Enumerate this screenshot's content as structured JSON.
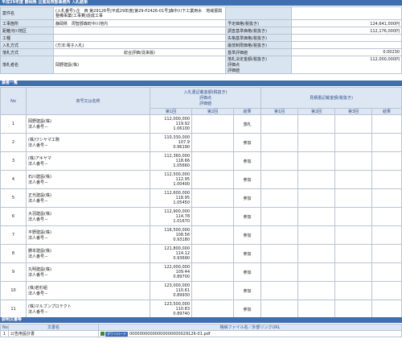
{
  "page_title": "平成29年度 静岡県 企業局西部事務所 入札結果",
  "info": {
    "rows": [
      {
        "l1": "案件名",
        "v1": "(入札番号):企　西 第29126号|平成29年度[第29-P2426-01号]森中川下工業用水　地域振興整備事業(工事費)造成工事",
        "l2": "",
        "v2": ""
      },
      {
        "l1": "工事箇所",
        "v1": "静岡県　周智郡森町中川地内",
        "l2": "予定価格(税抜き)",
        "v2": "124,641,000円"
      },
      {
        "l1": "距離河川地区",
        "v1": "",
        "l2": "調査基準価格(税抜き)",
        "v2": "112,176,000円"
      },
      {
        "l1": "工種",
        "v1": "",
        "l2": "失格基準価格(税抜き)",
        "v2": ""
      },
      {
        "l1": "入札方式",
        "v1": "(方法:電子入札)",
        "l2": "最低制限価格(税抜き)",
        "v2": ""
      },
      {
        "l1": "落札方式",
        "v1": "総合評価(従来版)",
        "l2": "基準評価値",
        "v2": "0.00230"
      },
      {
        "l1": "落札者名",
        "v1": "岡野建設(株)",
        "l2": "落札決定金額(税抜き)",
        "v2": "112,000,000円"
      }
    ],
    "extra_labels": [
      "評価点",
      "評価値"
    ]
  },
  "bidders_section": {
    "title": "業者一覧",
    "col_no": "No",
    "col_name": "商号又は名称",
    "col_bid": "入札書記載金額(税抜き)",
    "col_bid_sub1": "評価点",
    "col_bid_sub2": "評価値",
    "col_redo": "見積書記載金額(税抜き)",
    "col_round1": "第1回",
    "col_round2": "第2回",
    "col_round3": "第3回",
    "col_result": "結果",
    "reg_label": "法人番号－",
    "rows": [
      {
        "no": "1",
        "name": "岡野建設(株)",
        "amount": "112,000,000",
        "points": "119.92",
        "value": "1.06100",
        "result": "落札"
      },
      {
        "no": "2",
        "name": "(株)ワシヤマ工務",
        "amount": "110,330,000",
        "points": "107.9",
        "value": "0.96190",
        "result": "参加"
      },
      {
        "no": "3",
        "name": "(株)アキヤマ",
        "amount": "112,360,000",
        "points": "118.66",
        "value": "1.05660",
        "result": "参加"
      },
      {
        "no": "4",
        "name": "石川建設(株)",
        "amount": "112,500,000",
        "points": "112.95",
        "value": "1.00400",
        "result": "参加"
      },
      {
        "no": "5",
        "name": "正光建設(株)",
        "amount": "112,600,000",
        "points": "118.95",
        "value": "1.05450",
        "result": "参加"
      },
      {
        "no": "6",
        "name": "大羽建設(株)",
        "amount": "112,900,000",
        "points": "114.78",
        "value": "1.01670",
        "result": "参加"
      },
      {
        "no": "7",
        "name": "平野建設(株)",
        "amount": "116,500,000",
        "points": "108.56",
        "value": "0.93180",
        "result": "参加"
      },
      {
        "no": "8",
        "name": "勝本建設(株)",
        "amount": "121,800,000",
        "points": "114.12",
        "value": "0.93690",
        "result": "参加"
      },
      {
        "no": "9",
        "name": "丸明建設(株)",
        "amount": "122,000,000",
        "points": "109.44",
        "value": "0.89700",
        "result": "参加"
      },
      {
        "no": "10",
        "name": "(株)若杉組",
        "amount": "123,000,000",
        "points": "110.61",
        "value": "0.89930",
        "result": "参加"
      },
      {
        "no": "11",
        "name": "(株)マルブンプロテクト",
        "amount": "123,500,000",
        "points": "110.83",
        "value": "0.89740",
        "result": "参加"
      }
    ]
  },
  "docs_section": {
    "title": "説明文書等",
    "col_no": "No",
    "col_doc": "文書名",
    "col_file": "格納ファイル名／外部リンクURL",
    "rows": [
      {
        "no": "1",
        "doc": "公告用設計書",
        "download": "ダウンロード",
        "file": "00000000000000000000029126-01.pdf"
      }
    ]
  }
}
